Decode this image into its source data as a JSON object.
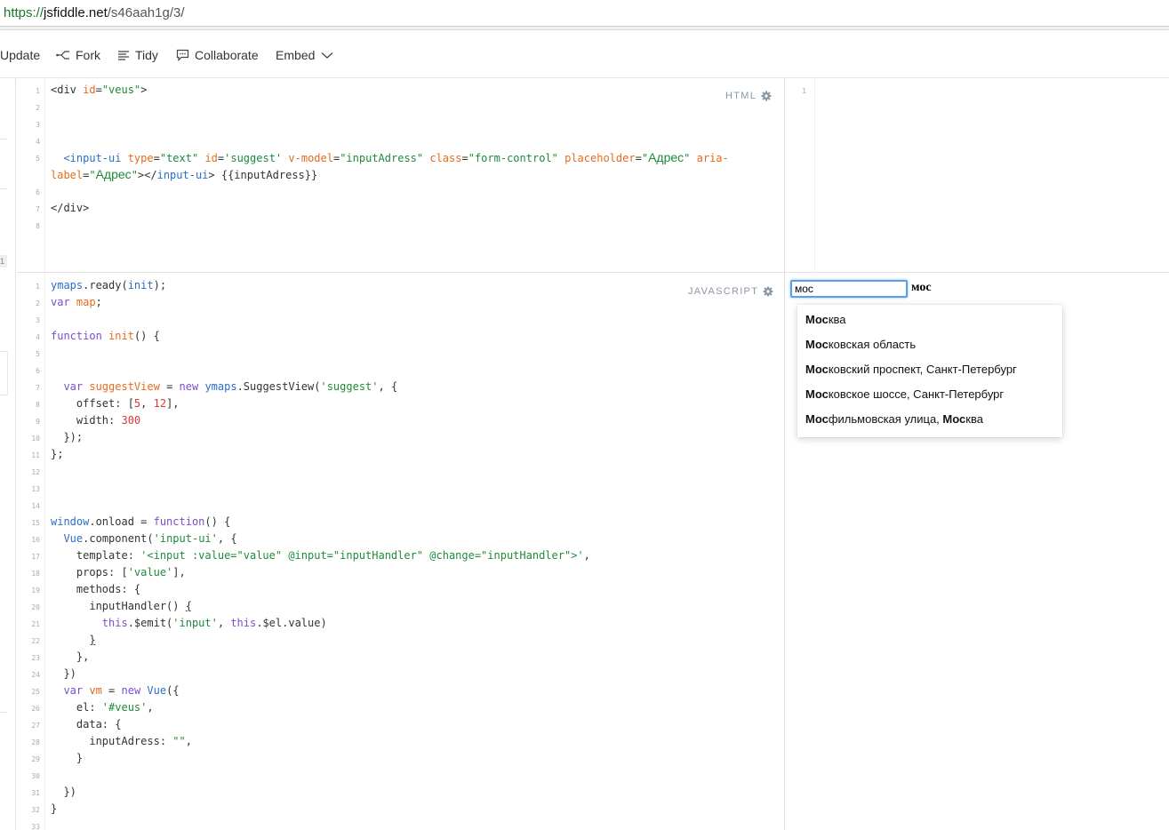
{
  "urlbar": {
    "scheme": "https://",
    "host": "jsfiddle.net",
    "path": "/s46aah1g/3/"
  },
  "toolbar": {
    "update": "Update",
    "fork": "Fork",
    "tidy": "Tidy",
    "collaborate": "Collaborate",
    "embed": "Embed"
  },
  "left_badge": "1",
  "html_panel": {
    "label": "HTML",
    "line_numbers": [
      "1",
      "2",
      "3",
      "4",
      "5",
      "",
      "6",
      "7",
      "8"
    ]
  },
  "js_panel": {
    "label": "JAVASCRIPT",
    "line_numbers": [
      "1",
      "2",
      "3",
      "4",
      "5",
      "6",
      "7",
      "8",
      "9",
      "10",
      "11",
      "12",
      "13",
      "14",
      "15",
      "16",
      "17",
      "18",
      "19",
      "20",
      "21",
      "22",
      "23",
      "24",
      "25",
      "26",
      "27",
      "28",
      "29",
      "30",
      "31",
      "32",
      "33"
    ]
  },
  "result": {
    "line_number": "1",
    "input_value": "мос",
    "echo": "мос",
    "suggestions": [
      {
        "bold": "Мос",
        "rest": "ква",
        "tail_bold": "",
        "tail": ""
      },
      {
        "bold": "Мос",
        "rest": "ковская область",
        "tail_bold": "",
        "tail": ""
      },
      {
        "bold": "Мос",
        "rest": "ковский проспект, Санкт-Петербург",
        "tail_bold": "",
        "tail": ""
      },
      {
        "bold": "Мос",
        "rest": "ковское шоссе, Санкт-Петербург",
        "tail_bold": "",
        "tail": ""
      },
      {
        "bold": "Мос",
        "rest": "фильмовская улица, ",
        "tail_bold": "Мос",
        "tail": "ква"
      }
    ]
  },
  "code": {
    "html": {
      "l1_open": "<div ",
      "l1_attr": "id",
      "l1_eq": "=",
      "l1_val": "\"veus\"",
      "l1_close": ">",
      "l5_open": "<input-ui ",
      "l5_a1": "type",
      "l5_v1": "\"text\"",
      "l5_a2": "id",
      "l5_v2": "'suggest'",
      "l5_a3": "v-model",
      "l5_v3": "\"inputAdress\"",
      "l5_a4": "class",
      "l5_v4": "\"form-control\"",
      "l5_a5": "placeholder",
      "l5_v5a": "\"",
      "l5_v5b": "Адрес",
      "l5_v5c": "\"",
      "l5_a6": "aria-",
      "l5b_a6": "label",
      "l5b_v6a": "\"",
      "l5b_v6b": "Адрес",
      "l5b_v6c": "\"",
      "l5b_close": "></",
      "l5b_tag": "input-ui",
      "l5b_end": "> {{inputAdress}}",
      "l7": "</div>"
    },
    "js": {
      "l1a": "ymaps",
      "l1b": ".ready(",
      "l1c": "init",
      "l1d": ");",
      "l2a": "var ",
      "l2b": "map",
      "l2c": ";",
      "l4a": "function ",
      "l4b": "init",
      "l4c": "() {",
      "l7a": "  var ",
      "l7b": "suggestView",
      "l7c": " = ",
      "l7d": "new ",
      "l7e": "ymaps",
      "l7f": ".SuggestView(",
      "l7g": "'suggest'",
      "l7h": ", {",
      "l8a": "    offset: [",
      "l8b": "5",
      "l8c": ", ",
      "l8d": "12",
      "l8e": "],",
      "l9a": "    width: ",
      "l9b": "300",
      "l10": "  });",
      "l11": "};",
      "l15a": "window",
      "l15b": ".onload = ",
      "l15c": "function",
      "l15d": "() {",
      "l16a": "  ",
      "l16b": "Vue",
      "l16c": ".component(",
      "l16d": "'input-ui'",
      "l16e": ", {",
      "l17a": "    template: ",
      "l17b": "'<input :value=\"value\" @input=\"inputHandler\" @change=\"inputHandler\">'",
      "l17c": ",",
      "l18a": "    props: [",
      "l18b": "'value'",
      "l18c": "],",
      "l19": "    methods: {",
      "l20a": "      inputHandler() ",
      "l20b": "{",
      "l21a": "        ",
      "l21b": "this",
      "l21c": ".$emit(",
      "l21d": "'input'",
      "l21e": ", ",
      "l21f": "this",
      "l21g": ".$el.value)",
      "l22a": "      ",
      "l22b": "}",
      "l23": "    },",
      "l24": "  })",
      "l25a": "  var ",
      "l25b": "vm",
      "l25c": " = ",
      "l25d": "new ",
      "l25e": "Vue",
      "l25f": "({",
      "l26a": "    el: ",
      "l26b": "'#veus'",
      "l26c": ",",
      "l27": "    data: {",
      "l28a": "      inputAdress: ",
      "l28b": "\"\"",
      "l28c": ",",
      "l29": "    }",
      "l31": "  })",
      "l32": "}"
    }
  }
}
